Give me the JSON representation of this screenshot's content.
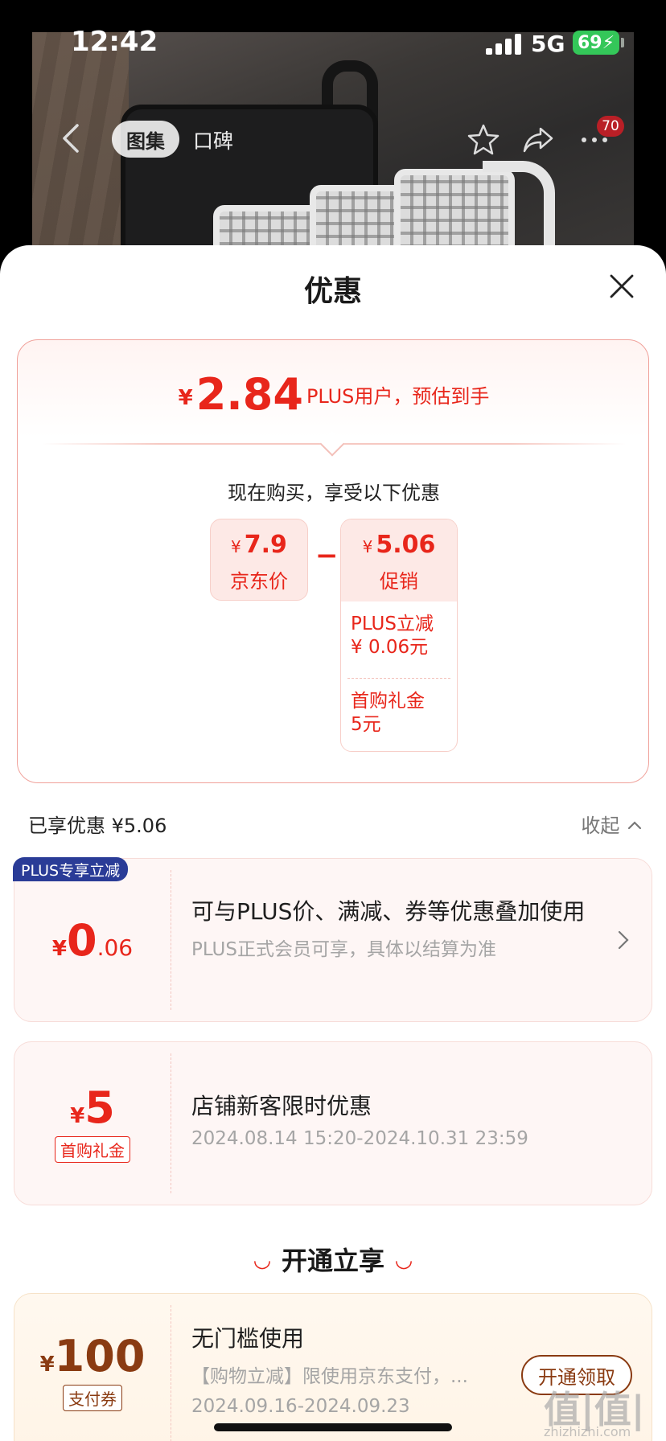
{
  "status_bar": {
    "time": "12:42",
    "network": "5G",
    "battery": "69"
  },
  "photo_nav": {
    "tabs": [
      "图集",
      "口碑"
    ],
    "badge_count": "70"
  },
  "sheet": {
    "title": "优惠"
  },
  "summary": {
    "currency": "¥",
    "estimated_price": "2.84",
    "estimated_note": "PLUS用户，预估到手",
    "buy_now_text": "现在购买，享受以下优惠",
    "jd_price": {
      "value": "7.9",
      "label": "京东价"
    },
    "minus_sign": "−",
    "promotion": {
      "value": "5.06",
      "label": "促销",
      "items": [
        {
          "line1": "PLUS立减",
          "line2": "¥ 0.06元"
        },
        {
          "line1": "首购礼金",
          "line2": "5元"
        }
      ]
    }
  },
  "enjoyed": {
    "text": "已享优惠 ¥5.06",
    "collapse_label": "收起"
  },
  "coupons": [
    {
      "tag": "PLUS专享立减",
      "currency": "¥",
      "amount_int": "0",
      "amount_dec": ".06",
      "title": "可与PLUS价、满减、券等优惠叠加使用",
      "subtitle": "PLUS正式会员可享，具体以结算为准"
    },
    {
      "currency": "¥",
      "amount_int": "5",
      "small_tag": "首购礼金",
      "title": "店铺新客限时优惠",
      "subtitle": "2024.08.14 15:20-2024.10.31 23:59"
    }
  ],
  "open_section": {
    "title": "开通立享",
    "coupon": {
      "currency": "¥",
      "amount": "100",
      "small_tag": "支付券",
      "title": "无门槛使用",
      "subtitle": "【购物立减】限使用京东支付，...",
      "date": "2024.09.16-2024.09.23",
      "button": "开通领取"
    }
  },
  "watermark": {
    "main": "值|值|值",
    "sub": "zhizhizhi.com"
  },
  "colors": {
    "accent_red": "#e8261b",
    "plus_blue": "#2a3c97",
    "gold_brown": "#8a3b12"
  }
}
